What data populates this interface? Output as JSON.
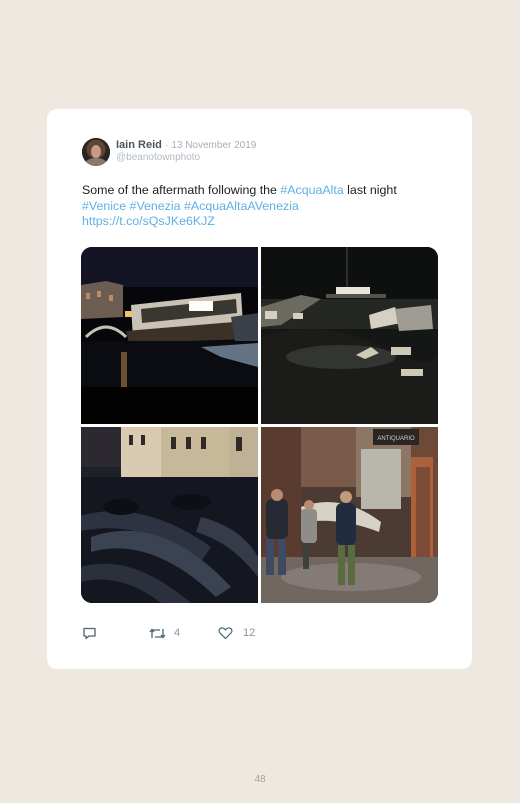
{
  "tweet": {
    "author_name": "Iain Reid",
    "separator": "·",
    "date": "13 November 2019",
    "handle": "@beanotownphoto",
    "text_lead": "Some of the aftermath following the ",
    "hashtag_acquaalta": "#AcquaAlta",
    "text_after": " last night",
    "hashtag_venice": "#Venice",
    "hashtag_venezia": "#Venezia",
    "hashtag_acquaaltaavenezia": "#AcquaAltaAVenezia",
    "link": "https://t.co/sQsJKe6KJZ"
  },
  "media": {
    "photos": [
      {
        "icon": "photo-night-waterbus"
      },
      {
        "icon": "photo-night-flooded-quay"
      },
      {
        "icon": "photo-gondolas-at-night"
      },
      {
        "icon": "photo-flooded-alley-people"
      }
    ],
    "shop_sign": "ANTIQUARIO"
  },
  "actions": {
    "reply_icon": "reply-icon",
    "retweet_icon": "retweet-icon",
    "retweet_count": "4",
    "like_icon": "heart-icon",
    "like_count": "12"
  },
  "page": {
    "number": "48"
  },
  "colors": {
    "background": "#efe8e1",
    "card": "#ffffff",
    "link": "#5fb0e5",
    "muted": "#8b949c"
  }
}
